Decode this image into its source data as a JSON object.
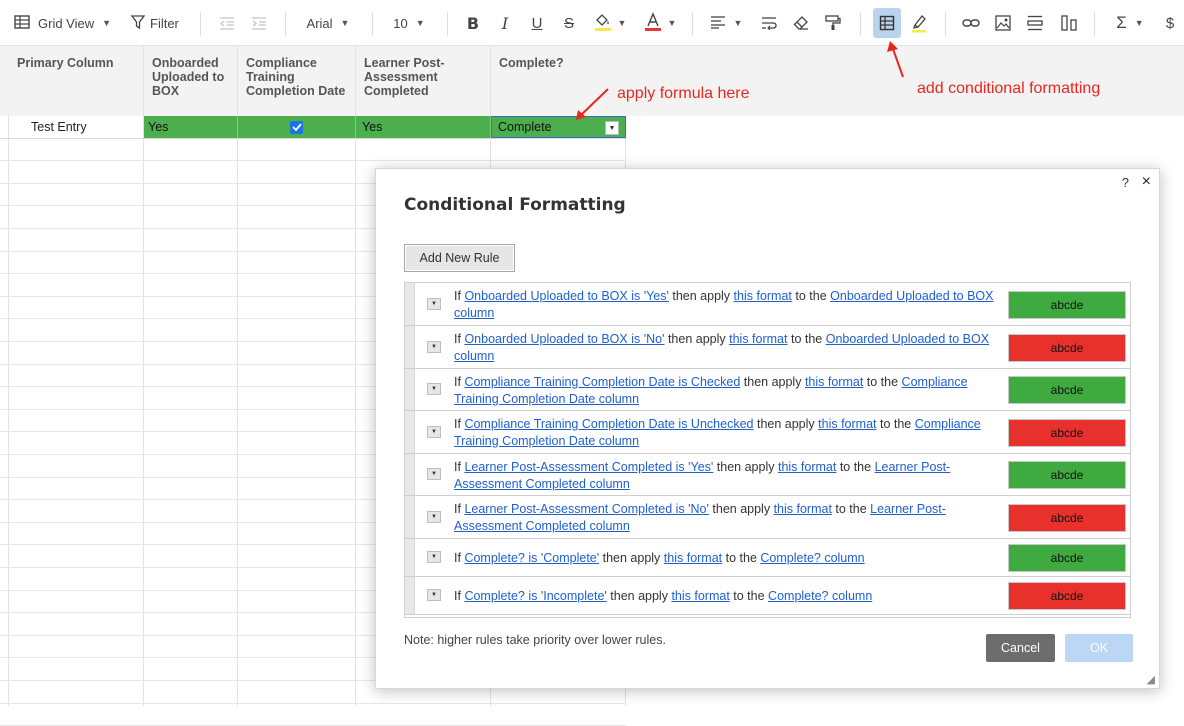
{
  "toolbar": {
    "view_label": "Grid View",
    "filter_label": "Filter",
    "font_name": "Arial",
    "font_size": "10",
    "sigma": "Σ",
    "dollar": "$"
  },
  "columns": [
    {
      "label": "Primary Column"
    },
    {
      "label": "Onboarded Uploaded to BOX"
    },
    {
      "label": "Compliance Training Completion Date"
    },
    {
      "label": "Learner Post-Assessment Completed"
    },
    {
      "label": "Complete?"
    }
  ],
  "row1": {
    "primary": "Test Entry",
    "onboarded": "Yes",
    "compliance_checked": true,
    "learner": "Yes",
    "complete": "Complete"
  },
  "annotations": {
    "apply_formula": "apply formula here",
    "add_conditional": "add conditional formatting"
  },
  "dialog": {
    "title": "Conditional Formatting",
    "help": "?",
    "close": "×",
    "add_rule": "Add New Rule",
    "note": "Note: higher rules take priority over lower rules.",
    "cancel": "Cancel",
    "ok": "OK",
    "swatch_text": "abcde",
    "green": "#3faa3f",
    "red": "#e8312d",
    "rules": [
      {
        "if": "If",
        "cond": "Onboarded Uploaded to BOX is 'Yes'",
        "then": "then apply",
        "fmt": "this format",
        "to": "to the",
        "target": "Onboarded Uploaded to BOX column",
        "color": "green"
      },
      {
        "if": "If",
        "cond": "Onboarded Uploaded to BOX is 'No'",
        "then": "then apply",
        "fmt": "this format",
        "to": "to the",
        "target": "Onboarded Uploaded to BOX column",
        "color": "red"
      },
      {
        "if": "If",
        "cond": "Compliance Training Completion Date is Checked",
        "then": "then apply",
        "fmt": "this format",
        "to": "to the",
        "target": "Compliance Training Completion Date column",
        "color": "green"
      },
      {
        "if": "If",
        "cond": "Compliance Training Completion Date is Unchecked",
        "then": "then apply",
        "fmt": "this format",
        "to": "to the",
        "target": "Compliance Training Completion Date column",
        "color": "red"
      },
      {
        "if": "If",
        "cond": "Learner Post-Assessment Completed is 'Yes'",
        "then": "then apply",
        "fmt": "this format",
        "to": "to the",
        "target": "Learner Post-Assessment Completed column",
        "color": "green"
      },
      {
        "if": "If",
        "cond": "Learner Post-Assessment Completed is 'No'",
        "then": "then apply",
        "fmt": "this format",
        "to": "to the",
        "target": "Learner Post-Assessment Completed column",
        "color": "red"
      },
      {
        "if": "If",
        "cond": "Complete? is 'Complete'",
        "then": "then apply",
        "fmt": "this format",
        "to": "to the",
        "target": "Complete? column",
        "color": "green"
      },
      {
        "if": "If",
        "cond": "Complete? is 'Incomplete'",
        "then": "then apply",
        "fmt": "this format",
        "to": "to the",
        "target": "Complete? column",
        "color": "red"
      }
    ]
  }
}
